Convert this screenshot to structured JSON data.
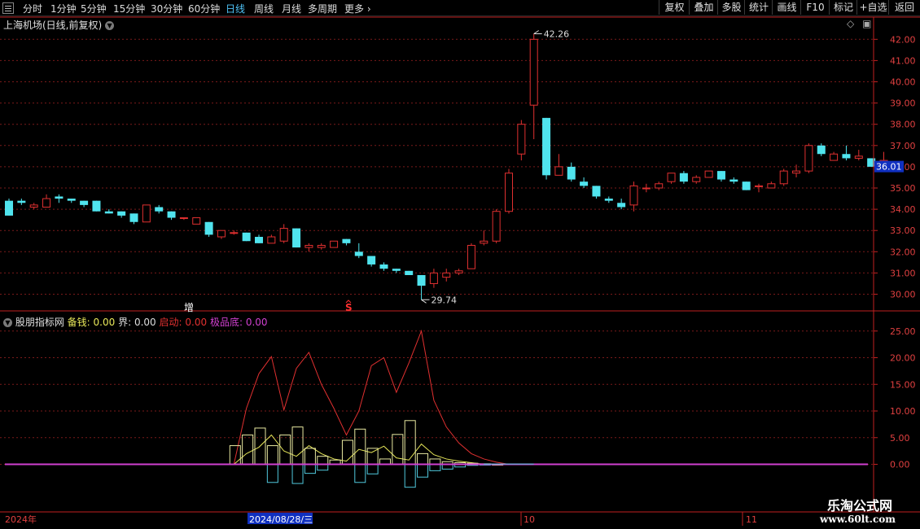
{
  "toolbar": {
    "periods": [
      "分时",
      "1分钟",
      "5分钟",
      "15分钟",
      "30分钟",
      "60分钟",
      "日线",
      "周线",
      "月线",
      "多周期",
      "更多"
    ],
    "active_period": "日线",
    "buttons": [
      "复权",
      "叠加",
      "多股",
      "统计",
      "画线",
      "F10",
      "标记",
      "+自选",
      "返回"
    ]
  },
  "price_panel": {
    "title": "上海机场(日线,前复权)",
    "high_label": "42.26",
    "low_label": "29.74",
    "current_price": "36.01",
    "marker_zeng": "增",
    "marker_s": "S"
  },
  "indicator_panel": {
    "title": "股朋指标网",
    "fields": [
      {
        "name": "备钱:",
        "value": "0.00",
        "color": "#e8e85a"
      },
      {
        "name": "界:",
        "value": "0.00",
        "color": "#dddddd"
      },
      {
        "name": "启动:",
        "value": "0.00",
        "color": "#e03030"
      },
      {
        "name": "极品底:",
        "value": "0.00",
        "color": "#d040d0"
      }
    ]
  },
  "bottom_axis": {
    "labels": [
      "2024年",
      "2024/08/28/三",
      "10",
      "11"
    ]
  },
  "watermark": {
    "line1": "乐淘公式网",
    "line2": "www.60lt.com"
  },
  "colors": {
    "up": "#e03030",
    "down": "#50e4ee",
    "grid": "#7a1a1a",
    "axis": "#c02020"
  },
  "chart_data": [
    {
      "type": "candlestick",
      "title": "上海机场(日线,前复权)",
      "y_ticks": [
        "30.00",
        "31.00",
        "32.00",
        "33.00",
        "34.00",
        "35.00",
        "36.00",
        "37.00",
        "38.00",
        "39.00",
        "40.00",
        "41.00",
        "42.00"
      ],
      "ylim": [
        29.0,
        42.6
      ],
      "candles": [
        [
          34.4,
          34.5,
          33.7,
          33.7
        ],
        [
          34.4,
          34.5,
          34.2,
          34.3
        ],
        [
          34.1,
          34.3,
          34.0,
          34.2
        ],
        [
          34.1,
          34.7,
          34.1,
          34.5
        ],
        [
          34.6,
          34.7,
          34.3,
          34.5
        ],
        [
          34.5,
          34.5,
          34.3,
          34.4
        ],
        [
          34.4,
          34.4,
          34.1,
          34.2
        ],
        [
          34.4,
          34.4,
          33.9,
          33.9
        ],
        [
          33.9,
          34.0,
          33.8,
          33.8
        ],
        [
          33.9,
          33.9,
          33.6,
          33.7
        ],
        [
          33.8,
          33.8,
          33.3,
          33.4
        ],
        [
          33.4,
          34.2,
          33.4,
          34.2
        ],
        [
          34.1,
          34.2,
          33.8,
          33.9
        ],
        [
          33.9,
          33.9,
          33.5,
          33.6
        ],
        [
          33.6,
          33.6,
          33.5,
          33.6
        ],
        [
          33.3,
          33.6,
          33.3,
          33.6
        ],
        [
          33.4,
          33.4,
          32.7,
          32.8
        ],
        [
          32.7,
          33.0,
          32.6,
          33.0
        ],
        [
          32.9,
          33.0,
          32.8,
          32.9
        ],
        [
          32.9,
          32.9,
          32.5,
          32.5
        ],
        [
          32.7,
          32.8,
          32.4,
          32.4
        ],
        [
          32.4,
          32.8,
          32.4,
          32.7
        ],
        [
          32.5,
          33.3,
          32.4,
          33.1
        ],
        [
          33.1,
          33.1,
          32.2,
          32.2
        ],
        [
          32.2,
          32.4,
          32.0,
          32.3
        ],
        [
          32.2,
          32.4,
          32.1,
          32.3
        ],
        [
          32.2,
          32.5,
          32.2,
          32.5
        ],
        [
          32.6,
          32.6,
          32.3,
          32.4
        ],
        [
          32.0,
          32.4,
          31.7,
          31.8
        ],
        [
          31.8,
          31.8,
          31.3,
          31.4
        ],
        [
          31.4,
          31.5,
          31.1,
          31.2
        ],
        [
          31.2,
          31.2,
          31.0,
          31.1
        ],
        [
          31.1,
          31.1,
          30.9,
          30.9
        ],
        [
          30.9,
          30.9,
          29.74,
          30.4
        ],
        [
          30.5,
          31.2,
          30.3,
          31.0
        ],
        [
          30.8,
          31.2,
          30.6,
          31.0
        ],
        [
          31.0,
          31.2,
          30.9,
          31.1
        ],
        [
          31.2,
          32.4,
          31.2,
          32.3
        ],
        [
          32.4,
          33.0,
          32.3,
          32.5
        ],
        [
          32.5,
          34.0,
          32.4,
          33.9
        ],
        [
          33.9,
          35.9,
          33.8,
          35.7
        ],
        [
          36.6,
          38.2,
          36.3,
          38.0
        ],
        [
          38.9,
          42.26,
          37.3,
          42.0
        ],
        [
          38.3,
          38.3,
          35.4,
          35.6
        ],
        [
          35.6,
          36.6,
          35.6,
          36.0
        ],
        [
          36.0,
          36.2,
          35.3,
          35.4
        ],
        [
          35.3,
          35.5,
          35.0,
          35.1
        ],
        [
          35.1,
          35.1,
          34.5,
          34.6
        ],
        [
          34.5,
          34.6,
          34.3,
          34.4
        ],
        [
          34.3,
          34.5,
          34.0,
          34.1
        ],
        [
          34.2,
          35.3,
          33.9,
          35.1
        ],
        [
          35.0,
          35.2,
          34.8,
          35.0
        ],
        [
          35.0,
          35.3,
          34.9,
          35.2
        ],
        [
          35.3,
          35.7,
          35.2,
          35.7
        ],
        [
          35.7,
          35.8,
          35.2,
          35.3
        ],
        [
          35.3,
          35.6,
          35.2,
          35.5
        ],
        [
          35.5,
          35.8,
          35.5,
          35.8
        ],
        [
          35.8,
          35.8,
          35.3,
          35.4
        ],
        [
          35.4,
          35.5,
          35.2,
          35.3
        ],
        [
          35.3,
          35.3,
          34.9,
          34.9
        ],
        [
          35.1,
          35.2,
          34.8,
          35.1
        ],
        [
          35.0,
          35.3,
          35.0,
          35.2
        ],
        [
          35.2,
          35.9,
          35.1,
          35.8
        ],
        [
          35.7,
          36.1,
          35.5,
          35.8
        ],
        [
          35.8,
          37.1,
          35.7,
          37.0
        ],
        [
          37.0,
          37.1,
          36.5,
          36.6
        ],
        [
          36.3,
          36.7,
          36.3,
          36.6
        ],
        [
          36.6,
          37.0,
          36.3,
          36.4
        ],
        [
          36.4,
          36.8,
          36.3,
          36.5
        ],
        [
          36.4,
          36.4,
          36.0,
          36.0
        ],
        [
          36.1,
          36.7,
          36.0,
          36.3
        ]
      ]
    },
    {
      "type": "bar",
      "title": "股朋指标网",
      "y_ticks": [
        "0.00",
        "5.00",
        "10.00",
        "15.00",
        "20.00",
        "25.00"
      ],
      "ylim": [
        -4.6,
        26.5
      ],
      "series": [
        {
          "name": "启动",
          "type": "line",
          "color": "#e03030",
          "points": [
            [
              18,
              0
            ],
            [
              19,
              10.5
            ],
            [
              20,
              17
            ],
            [
              21,
              20.2
            ],
            [
              22,
              10.2
            ],
            [
              23,
              18
            ],
            [
              24,
              21
            ],
            [
              25,
              15
            ],
            [
              26,
              10.5
            ],
            [
              27,
              5.5
            ],
            [
              28,
              10
            ],
            [
              29,
              18.5
            ],
            [
              30,
              20
            ],
            [
              31,
              13.5
            ],
            [
              32,
              19
            ],
            [
              33,
              25
            ],
            [
              34,
              12
            ],
            [
              35,
              7
            ],
            [
              36,
              4
            ],
            [
              37,
              2
            ],
            [
              38,
              1
            ],
            [
              39,
              0.4
            ],
            [
              40,
              0
            ]
          ]
        },
        {
          "name": "备钱",
          "type": "line",
          "color": "#e8e85a",
          "points": [
            [
              18,
              0
            ],
            [
              19,
              2
            ],
            [
              20,
              3.2
            ],
            [
              21,
              5.5
            ],
            [
              22,
              2.5
            ],
            [
              23,
              1.5
            ],
            [
              24,
              3.5
            ],
            [
              25,
              2
            ],
            [
              26,
              1
            ],
            [
              27,
              0.6
            ],
            [
              28,
              2.8
            ],
            [
              29,
              2.2
            ],
            [
              30,
              3.4
            ],
            [
              31,
              1.2
            ],
            [
              32,
              0.8
            ],
            [
              33,
              3.8
            ],
            [
              34,
              1.8
            ],
            [
              35,
              1
            ],
            [
              36,
              0.6
            ],
            [
              37,
              0.3
            ],
            [
              38,
              0
            ],
            [
              39,
              0
            ],
            [
              40,
              0
            ]
          ]
        },
        {
          "name": "界",
          "type": "bar",
          "color": "#e8e8a0",
          "points": [
            [
              18,
              3.5
            ],
            [
              19,
              5.5
            ],
            [
              20,
              6.8
            ],
            [
              21,
              3.5
            ],
            [
              22,
              5.5
            ],
            [
              23,
              7
            ],
            [
              24,
              3
            ],
            [
              25,
              1.5
            ],
            [
              26,
              0.8
            ],
            [
              27,
              4.5
            ],
            [
              28,
              6.6
            ],
            [
              29,
              3
            ],
            [
              30,
              1
            ],
            [
              31,
              5.6
            ],
            [
              32,
              8.2
            ],
            [
              33,
              2
            ],
            [
              34,
              1
            ],
            [
              35,
              0.5
            ],
            [
              36,
              0.3
            ],
            [
              37,
              0.2
            ],
            [
              38,
              0.1
            ],
            [
              39,
              0
            ]
          ]
        },
        {
          "name": "界-",
          "type": "bar",
          "color": "#50c8dc",
          "points": [
            [
              21,
              -3.4
            ],
            [
              23,
              -3.6
            ],
            [
              24,
              -1.7
            ],
            [
              25,
              -1.1
            ],
            [
              28,
              -3.4
            ],
            [
              29,
              -1.8
            ],
            [
              32,
              -4.3
            ],
            [
              33,
              -2.4
            ],
            [
              34,
              -1.2
            ],
            [
              35,
              -0.9
            ],
            [
              36,
              -0.5
            ],
            [
              37,
              -0.2
            ],
            [
              38,
              -0.1
            ]
          ]
        },
        {
          "name": "极品底",
          "type": "line",
          "color": "#d040d0",
          "points": [
            [
              0,
              0
            ],
            [
              70,
              0
            ]
          ]
        }
      ]
    }
  ]
}
